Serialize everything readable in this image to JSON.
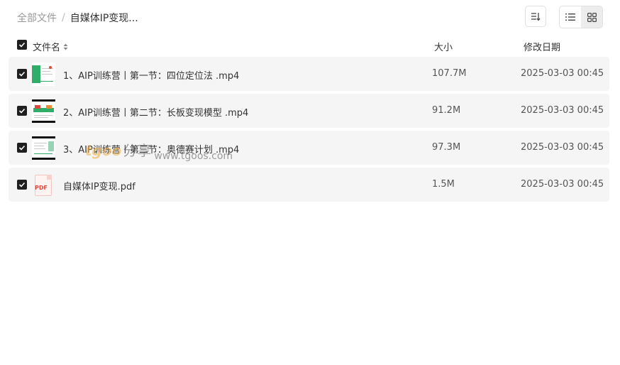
{
  "breadcrumb": {
    "root": "全部文件",
    "separator": "/",
    "current": "自媒体IP变现..."
  },
  "toolbar": {
    "sort_icon": "sort-list-icon",
    "list_view_icon": "list-view-icon",
    "grid_view_icon": "grid-view-icon",
    "active_view": "list"
  },
  "header": {
    "name": "文件名",
    "size": "大小",
    "date": "修改日期"
  },
  "files": [
    {
      "name": "1、AIP训练营丨第一节：四位定位法 .mp4",
      "size": "107.7M",
      "date": "2025-03-03 00:45",
      "type": "video"
    },
    {
      "name": "2、AIP训练营丨第二节：长板变现模型 .mp4",
      "size": "91.2M",
      "date": "2025-03-03 00:45",
      "type": "video"
    },
    {
      "name": "3、AIP训练营丨第三节：奥德赛计划 .mp4",
      "size": "97.3M",
      "date": "2025-03-03 00:45",
      "type": "video"
    },
    {
      "name": "自媒体IP变现.pdf",
      "size": "1.5M",
      "date": "2025-03-03 00:45",
      "type": "pdf",
      "thumb_label": "PDF"
    }
  ],
  "watermark": {
    "logo": "tgoo",
    "han": "分享",
    "url": "www.tgoos.com"
  },
  "colors": {
    "row_bg": "#f5f5f6",
    "check": "#1f1f1f",
    "accent_green": "#2fae69",
    "pdf_red": "#e04a3c"
  }
}
